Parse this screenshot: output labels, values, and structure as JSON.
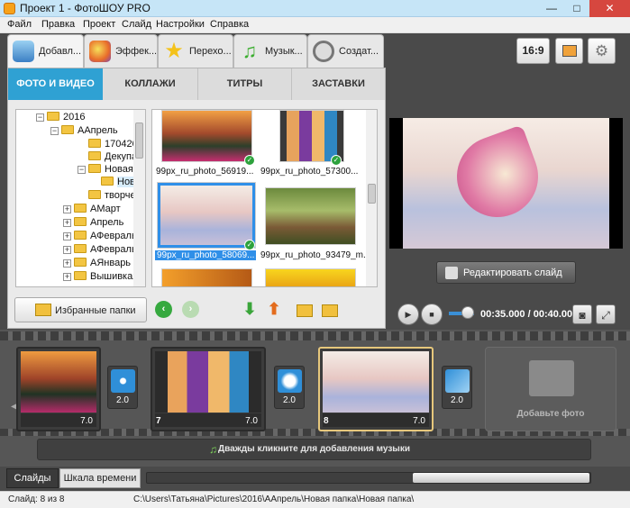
{
  "window": {
    "title": "Проект 1 - ФотоШОУ PRO",
    "min": "—",
    "max": "□",
    "close": "✕"
  },
  "menu": [
    "Файл",
    "Правка",
    "Проект",
    "Слайд",
    "Настройки",
    "Справка"
  ],
  "top_tabs": [
    {
      "label": "Добавл...",
      "icon": "add-photos-icon"
    },
    {
      "label": "Эффек...",
      "icon": "effects-palette-icon"
    },
    {
      "label": "Перехо...",
      "icon": "transitions-star-icon"
    },
    {
      "label": "Музык...",
      "icon": "music-note-icon"
    },
    {
      "label": "Создат...",
      "icon": "film-reel-icon"
    }
  ],
  "aspect_button": "16:9",
  "sub_tabs": [
    "ФОТО И ВИДЕО",
    "КОЛЛАЖИ",
    "ТИТРЫ",
    "ЗАСТАВКИ"
  ],
  "tree": [
    {
      "label": "2016",
      "expander": "−"
    },
    {
      "label": "ААпрель",
      "expander": "−"
    },
    {
      "label": "170420",
      "expander": ""
    },
    {
      "label": "Декупа",
      "expander": ""
    },
    {
      "label": "Новая п",
      "expander": "−"
    },
    {
      "label": "Нова",
      "expander": ""
    },
    {
      "label": "творче",
      "expander": ""
    },
    {
      "label": "АМарт",
      "expander": "+"
    },
    {
      "label": "Апрель",
      "expander": "+"
    },
    {
      "label": "АФевраль",
      "expander": "+"
    },
    {
      "label": "АФевраль2",
      "expander": "+"
    },
    {
      "label": "АЯнварь",
      "expander": "+"
    },
    {
      "label": "Вышивка2(",
      "expander": "+"
    }
  ],
  "thumbnails": [
    {
      "caption": "99px_ru_photo_56919...",
      "checked": true
    },
    {
      "caption": "99px_ru_photo_57300...",
      "checked": true
    },
    {
      "caption": "99px_ru_photo_58069...",
      "checked": true
    },
    {
      "caption": "99px_ru_photo_93479_m...",
      "checked": false
    }
  ],
  "favorites_button": "Избранные папки",
  "edit_slide_button": "Редактировать слайд",
  "player": {
    "time": "00:35.000 / 00:40.000",
    "play": "▶",
    "stop": "■",
    "progress_fraction": 0.875
  },
  "slides": [
    {
      "number": "",
      "duration": "7.0"
    },
    {
      "number": "7",
      "duration": "7.0"
    },
    {
      "number": "8",
      "duration": "7.0"
    }
  ],
  "transitions": [
    {
      "duration": "2.0"
    },
    {
      "duration": "2.0"
    },
    {
      "duration": "2.0"
    }
  ],
  "add_photo_label": "Добавьте фото",
  "music_hint": "Дважды кликните для добавления музыки",
  "bottom_tabs": [
    "Слайды",
    "Шкала времени"
  ],
  "status": {
    "slide_info": "Слайд: 8 из 8",
    "path": "C:\\Users\\Татьяна\\Pictures\\2016\\ААпрель\\Новая папка\\Новая папка\\"
  },
  "colors": {
    "accent": "#2fa1d3",
    "active_slide_border": "#e6c77c",
    "selection": "#2f8fe8"
  }
}
